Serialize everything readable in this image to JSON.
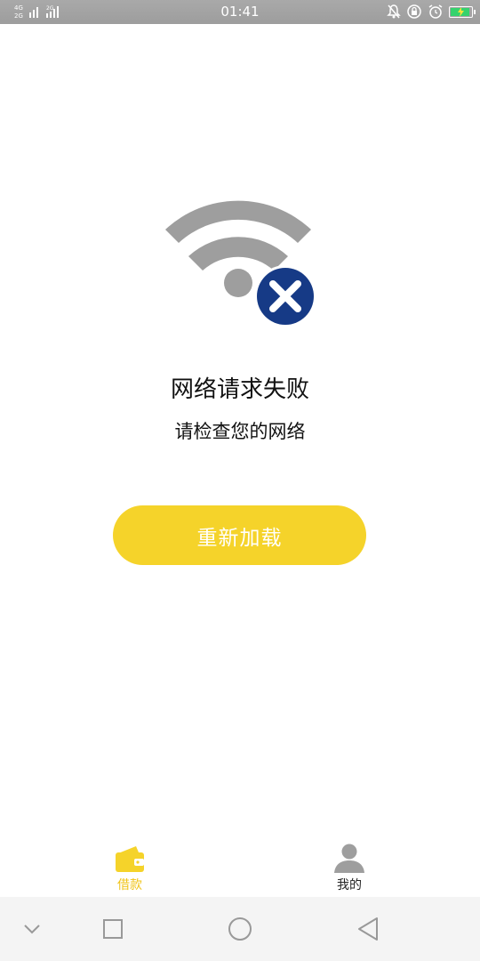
{
  "status_bar": {
    "network_primary": "4G",
    "network_secondary": "2G",
    "network_tertiary": "2G",
    "time": "01:41",
    "icons": [
      "bell-muted-icon",
      "rotation-lock-icon",
      "alarm-icon",
      "battery-charging-icon"
    ],
    "battery_color": "#35d26d"
  },
  "error_state": {
    "icon": "wifi-error-icon",
    "icon_color": "#9e9e9e",
    "badge_color": "#163a86",
    "title": "网络请求失败",
    "subtitle": "请检查您的网络",
    "reload_label": "重新加载",
    "reload_color": "#f5d32a"
  },
  "tab_bar": {
    "active_color": "#f0c419",
    "tabs": [
      {
        "label": "借款",
        "icon": "wallet-icon",
        "active": true
      },
      {
        "label": "我的",
        "icon": "user-icon",
        "active": false
      }
    ]
  },
  "nav_bar": {
    "buttons": [
      "chevron-down-icon",
      "square-icon",
      "circle-icon",
      "triangle-back-icon"
    ]
  }
}
